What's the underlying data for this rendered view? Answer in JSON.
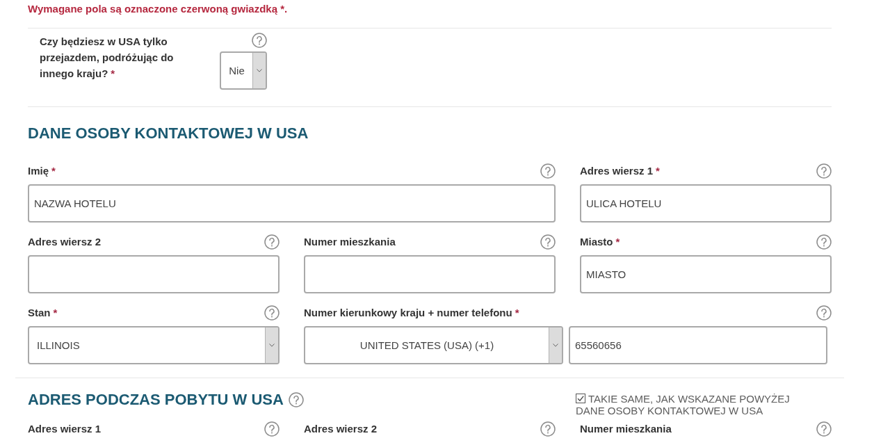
{
  "required_note": "Wymagane pola są oznaczone czerwoną gwiazdką *.",
  "required_mark": "*",
  "transit_question": {
    "label": "Czy będziesz w USA tylko przejazdem, podróżując do innego kraju?",
    "required": true,
    "value": "Nie"
  },
  "sections": [
    {
      "title": "DANE OSOBY KONTAKTOWEJ W USA",
      "help": false,
      "rows": [
        [
          {
            "kind": "text",
            "label": "Imię",
            "required": true,
            "value": "NAZWA HOTELU"
          },
          {
            "kind": "text",
            "label": "Adres wiersz 1",
            "required": true,
            "value": "ULICA HOTELU"
          }
        ],
        [
          {
            "kind": "text",
            "label": "Adres wiersz 2",
            "required": false
          },
          {
            "kind": "text",
            "label": "Numer mieszkania",
            "required": false
          },
          {
            "kind": "text",
            "label": "Miasto",
            "required": true,
            "value": "MIASTO"
          }
        ],
        [
          {
            "kind": "select",
            "label": "Stan",
            "required": true,
            "value": "ILLINOIS"
          },
          {
            "kind": "phone",
            "label": "Numer kierunkowy kraju + numer telefonu",
            "required": true,
            "country": "UNITED STATES (USA) (+1)",
            "value": "65560656"
          }
        ]
      ]
    },
    {
      "title": "ADRES PODCZAS POBYTU W USA",
      "help": true,
      "same_as_contact": {
        "label": "TAKIE SAME, JAK WSKAZANE POWYŻEJ DANE OSOBY KONTAKTOWEJ W USA",
        "checked": true
      },
      "rows": [
        [
          {
            "kind": "label",
            "label": "Adres wiersz 1",
            "required": false
          },
          {
            "kind": "label",
            "label": "Adres wiersz 2",
            "required": false
          },
          {
            "kind": "label",
            "label": "Numer mieszkania",
            "required": false
          }
        ]
      ]
    }
  ]
}
